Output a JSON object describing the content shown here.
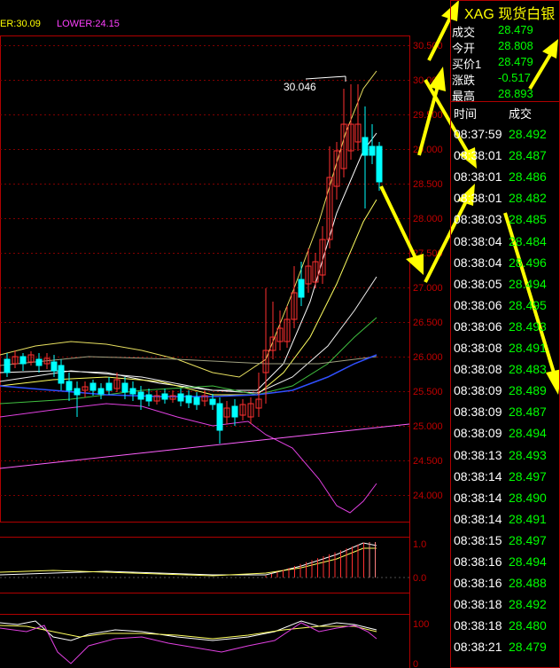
{
  "indicator": {
    "upper": "ER:30.09",
    "lower": "LOWER:24.15"
  },
  "price_axis": [
    "30.500",
    "30.000",
    "29.500",
    "29.000",
    "28.500",
    "28.000",
    "27.500",
    "27.000",
    "26.500",
    "26.000",
    "25.500",
    "25.000",
    "24.500",
    "24.000"
  ],
  "peak_label": "30.046",
  "sub1_axis": [
    "1.0",
    "0.0"
  ],
  "sub2_axis": [
    "100",
    "0"
  ],
  "quote": {
    "title": "XAG  现货白银",
    "rows": [
      {
        "k": "成交",
        "v": "28.479"
      },
      {
        "k": "今开",
        "v": "28.808"
      },
      {
        "k": "买价1",
        "v": "28.479"
      },
      {
        "k": "涨跌",
        "v": "-0.517"
      },
      {
        "k": "最高",
        "v": "28.893"
      }
    ],
    "ticks_header": {
      "time": "时间",
      "price": "成交"
    },
    "ticks": [
      {
        "t": "08:37:59",
        "p": "28.492"
      },
      {
        "t": "08:38:01",
        "p": "28.487"
      },
      {
        "t": "08:38:01",
        "p": "28.486"
      },
      {
        "t": "08:38:01",
        "p": "28.482"
      },
      {
        "t": "08:38:03",
        "p": "28.485"
      },
      {
        "t": "08:38:04",
        "p": "28.484"
      },
      {
        "t": "08:38:04",
        "p": "28.496"
      },
      {
        "t": "08:38:05",
        "p": "28.494"
      },
      {
        "t": "08:38:06",
        "p": "28.495"
      },
      {
        "t": "08:38:06",
        "p": "28.493"
      },
      {
        "t": "08:38:08",
        "p": "28.491"
      },
      {
        "t": "08:38:08",
        "p": "28.483"
      },
      {
        "t": "08:38:09",
        "p": "28.489"
      },
      {
        "t": "08:38:09",
        "p": "28.487"
      },
      {
        "t": "08:38:09",
        "p": "28.494"
      },
      {
        "t": "08:38:13",
        "p": "28.493"
      },
      {
        "t": "08:38:14",
        "p": "28.497"
      },
      {
        "t": "08:38:14",
        "p": "28.490"
      },
      {
        "t": "08:38:14",
        "p": "28.491"
      },
      {
        "t": "08:38:15",
        "p": "28.497"
      },
      {
        "t": "08:38:16",
        "p": "28.494"
      },
      {
        "t": "08:38:16",
        "p": "28.488"
      },
      {
        "t": "08:38:18",
        "p": "28.492"
      },
      {
        "t": "08:38:18",
        "p": "28.480"
      },
      {
        "t": "08:38:21",
        "p": "28.479"
      }
    ]
  },
  "colors": {
    "up": "#ff3030",
    "down": "#00ffff",
    "grid": "#b00000",
    "axis_text": "#c00000",
    "arrow": "#ffff00",
    "price": "#00ff00"
  }
}
